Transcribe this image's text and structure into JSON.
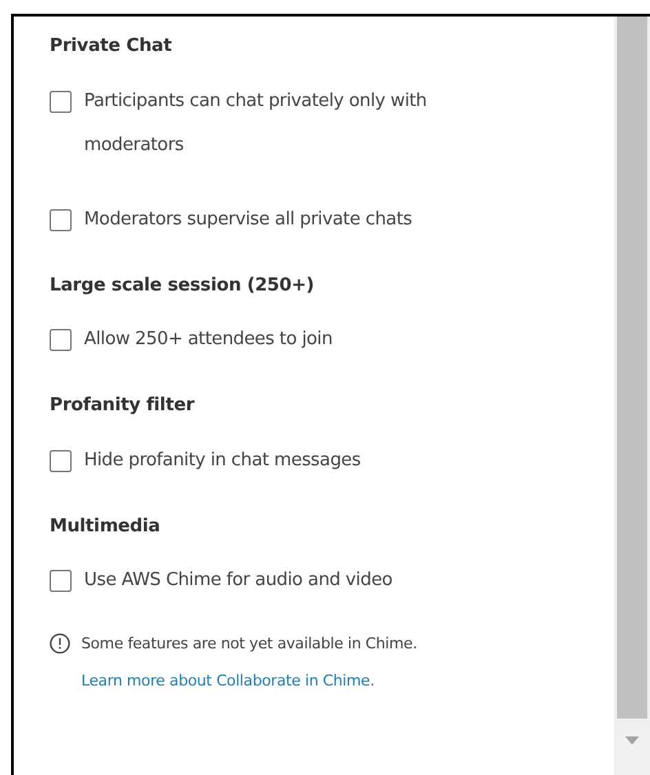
{
  "sections": [
    {
      "title": "Private Chat",
      "options": [
        {
          "label": "Participants can chat privately only with moderators",
          "checked": false
        },
        {
          "label": "Moderators supervise all private chats",
          "checked": false
        }
      ]
    },
    {
      "title": "Large scale session (250+)",
      "options": [
        {
          "label": "Allow 250+ attendees to join",
          "checked": false
        }
      ]
    },
    {
      "title": "Profanity filter",
      "options": [
        {
          "label": "Hide profanity in chat messages",
          "checked": false
        }
      ]
    },
    {
      "title": "Multimedia",
      "options": [
        {
          "label": "Use AWS Chime for audio and video",
          "checked": false
        }
      ]
    }
  ],
  "note": {
    "text": "Some features are not yet available in Chime.",
    "link": "Learn more about Collaborate in Chime."
  }
}
